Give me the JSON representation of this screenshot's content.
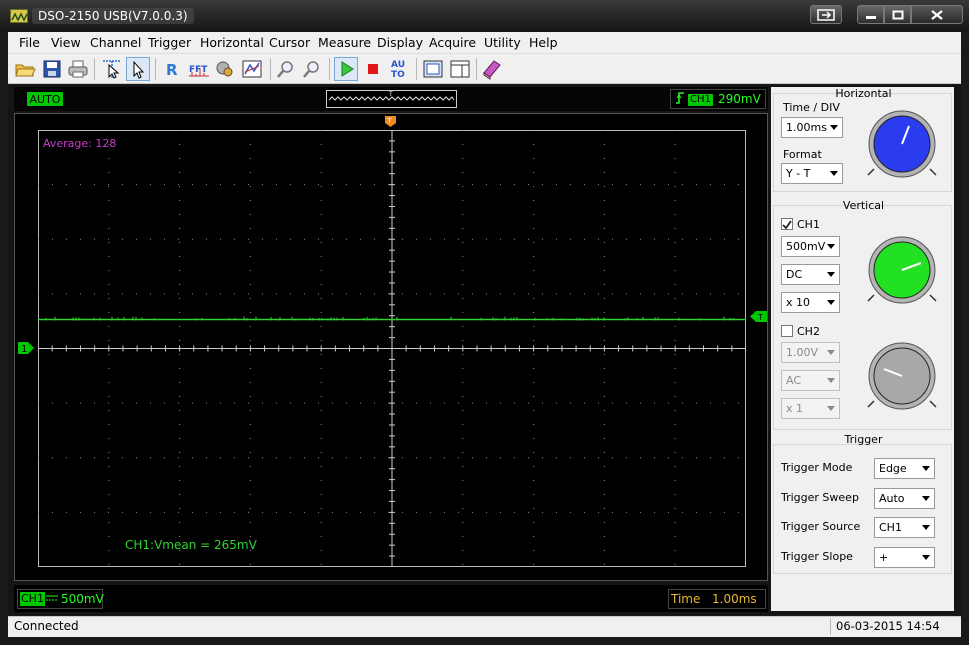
{
  "window": {
    "title": "DSO-2150 USB(V7.0.0.3)",
    "app_icon": "oscilloscope-app-icon",
    "controls": [
      "restore-alt-icon",
      "minimize-icon",
      "maximize-icon",
      "close-icon"
    ]
  },
  "menu": [
    "File",
    "View",
    "Channel",
    "Trigger",
    "Horizontal",
    "Cursor",
    "Measure",
    "Display",
    "Acquire",
    "Utility",
    "Help"
  ],
  "toolbar": {
    "buttons": [
      "open-folder-icon",
      "save-icon",
      "print-icon",
      "cursor-select-icon",
      "pointer-icon",
      "reference-icon",
      "fft-icon",
      "math-icon",
      "display-icon",
      "zoom-in-icon",
      "zoom-out-icon",
      "run-icon",
      "stop-icon",
      "auto-icon",
      "capture-icon",
      "panel-toggle-icon",
      "help-book-icon"
    ],
    "fft_text": "FFT",
    "reference_text": "R",
    "auto_text": "AU TO"
  },
  "scope": {
    "acq_mode": "AUTO",
    "trigger_channel": "CH1",
    "trigger_level": "290mV",
    "average_label": "Average: 128",
    "measurement": "CH1:Vmean = 265mV",
    "ch1_ground_marker": "1",
    "trigger_marker": "T",
    "colors": {
      "trace": "#2fd22f",
      "grid": "#8a8a8a",
      "average_text": "#c83cc8",
      "timebase_text": "#e8b832",
      "marker": "#00c800",
      "trigger_t_marker": "#f08a24"
    },
    "ch1_scale_tag": "CH1",
    "ch1_scale_value": "500mV",
    "timebase_label": "Time",
    "timebase_value": "1.00ms"
  },
  "panel": {
    "horizontal": {
      "title": "Horizontal",
      "time_div_label": "Time / DIV",
      "time_div_value": "1.00ms",
      "format_label": "Format",
      "format_value": "Y - T",
      "knob_color": "#2b3cf0"
    },
    "vertical": {
      "title": "Vertical",
      "ch1_label": "CH1",
      "ch1_checked": true,
      "ch1_volts": "500mV",
      "ch1_coupling": "DC",
      "ch1_probe": "x 10",
      "ch1_knob_color": "#22e022",
      "ch2_label": "CH2",
      "ch2_checked": false,
      "ch2_volts": "1.00V",
      "ch2_coupling": "AC",
      "ch2_probe": "x 1",
      "ch2_knob_color": "#a8a8a8"
    },
    "trigger": {
      "title": "Trigger",
      "rows": [
        {
          "label": "Trigger Mode",
          "value": "Edge"
        },
        {
          "label": "Trigger Sweep",
          "value": "Auto"
        },
        {
          "label": "Trigger Source",
          "value": "CH1"
        },
        {
          "label": "Trigger Slope",
          "value": "+"
        }
      ]
    }
  },
  "status": {
    "text": "Connected",
    "datetime": "06-03-2015  14:54"
  }
}
